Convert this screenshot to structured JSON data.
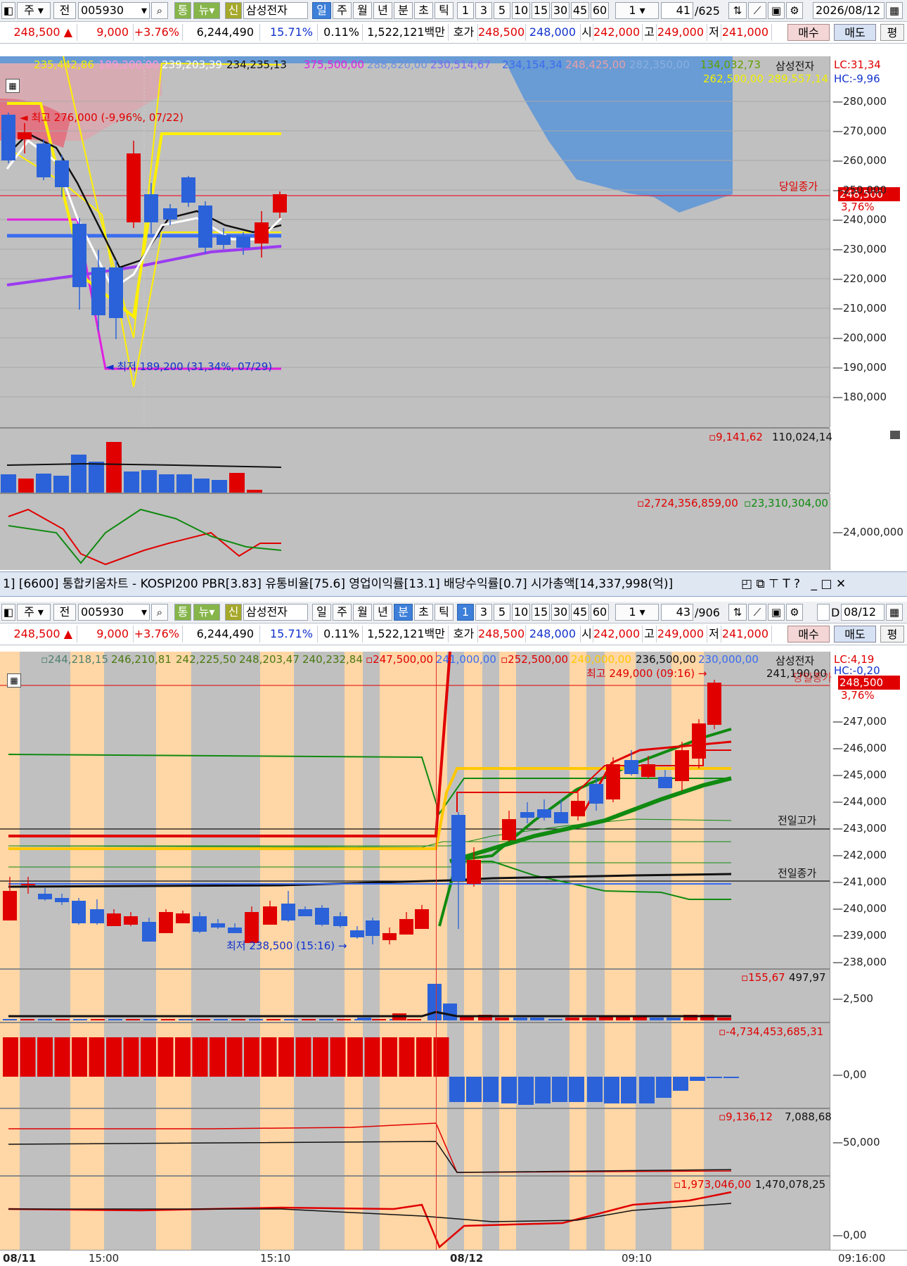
{
  "colors": {
    "up": "#e00000",
    "down": "#2b62d9",
    "panel": "#c0c0c0",
    "orange_band": "#ffd6a5"
  },
  "top": {
    "toolbar": {
      "type": "주",
      "prev": "전",
      "code": "005930",
      "btn_tong": "통",
      "btn_nyu": "뉴",
      "btn_sin": "신",
      "name": "삼성전자",
      "periods": [
        "일",
        "주",
        "월",
        "년",
        "분",
        "초",
        "틱"
      ],
      "selected_period": "일",
      "intervals": [
        "1",
        "3",
        "5",
        "10",
        "15",
        "30",
        "45",
        "60"
      ],
      "count": "1",
      "page": "41",
      "page_total": "/625",
      "date": "2026/08/12"
    },
    "info": {
      "price": "248,500 ▲",
      "change": "9,000",
      "pct": "+3.76%",
      "volume": "6,244,490",
      "turnover": "15.71%",
      "ratio": "0.11%",
      "amount": "1,522,121백만",
      "ask_label": "호가",
      "ask": "248,500",
      "bid": "248,000",
      "open_label": "시",
      "open": "242,000",
      "high_label": "고",
      "high": "249,000",
      "low_label": "저",
      "low": "241,000",
      "buy": "매수",
      "sell": "매도",
      "eval": "평"
    },
    "legend": {
      "v1": "235,442,86",
      "v2": "189,200,00",
      "v3": "239,203,39",
      "v4": "234,235,13",
      "v5": "375,500,00",
      "v6": "288,820,00",
      "v7": "230,514,67",
      "v8": "234,154,34",
      "v9": "248,425,00",
      "v10": "282,350,00",
      "v11": "134,032,73",
      "stock": "삼성전자",
      "lc": "LC:31,34",
      "v12": "262,500,00",
      "v13": "289,557,14",
      "hc": "HC:-9,96"
    },
    "annotations": {
      "high": "최고 276,000 (-9,96%, 07/22)",
      "low": "최저 189,200 (31,34%, 07/29)",
      "close_label": "당일종가",
      "price_box": "248,500",
      "price_pct": "3,76%"
    },
    "y_ticks": [
      "280,000",
      "270,000",
      "260,000",
      "250,000",
      "240,000",
      "230,000",
      "220,000",
      "210,000",
      "200,000",
      "190,000",
      "180,000"
    ],
    "vol_legend": {
      "a": "9,141,62",
      "b": "110,024,14"
    },
    "ind_legend": {
      "a": "2,724,356,859,00",
      "b": "23,310,304,00"
    },
    "ind_tick": "24,000,000"
  },
  "window": {
    "title": "1] [6600] 통합키움차트 - KOSPI200 PBR[3.83] 유통비율[75.6] 영업이익률[13.1] 배당수익률[0.7] 시가총액[14,337,998(억)]"
  },
  "bottom": {
    "toolbar": {
      "type": "주",
      "prev": "전",
      "code": "005930",
      "btn_tong": "통",
      "btn_nyu": "뉴",
      "btn_sin": "신",
      "name": "삼성전자",
      "periods": [
        "일",
        "주",
        "월",
        "년",
        "분",
        "초",
        "틱"
      ],
      "selected_period": "분",
      "intervals": [
        "1",
        "3",
        "5",
        "10",
        "15",
        "30",
        "45",
        "60"
      ],
      "selected_interval": "1",
      "count": "1",
      "page": "43",
      "page_total": "/906",
      "d_label": "D",
      "date": "08/12"
    },
    "info": {
      "price": "248,500 ▲",
      "change": "9,000",
      "pct": "+3.76%",
      "volume": "6,244,490",
      "turnover": "15.71%",
      "ratio": "0.11%",
      "amount": "1,522,121백만",
      "ask_label": "호가",
      "ask": "248,500",
      "bid": "248,000",
      "open_label": "시",
      "open": "242,000",
      "high_label": "고",
      "high": "249,000",
      "low_label": "저",
      "low": "241,000",
      "buy": "매수",
      "sell": "매도",
      "eval": "평"
    },
    "legend": {
      "v1": "244,218,15",
      "v2": "246,210,81",
      "v3": "242,225,50",
      "v4": "248,203,47",
      "v5": "240,232,84",
      "v6": "247,500,00",
      "v7": "241,000,00",
      "v8": "252,500,00",
      "v9": "240,000,00",
      "v10": "236,500,00",
      "v11": "230,000,00",
      "stock": "삼성전자",
      "lc": "LC:4,19",
      "hc": "HC:-0,20",
      "v12": "241,190,00"
    },
    "annotations": {
      "high": "최고 249,000 (09:16) →",
      "low": "최저 238,500 (15:16) →",
      "prev_high": "전일고가",
      "prev_close": "전일종가",
      "close_label": "당일종가",
      "price_box": "248,500",
      "price_pct": "3,76%"
    },
    "y_ticks": [
      "247,000",
      "246,000",
      "245,000",
      "244,000",
      "243,000",
      "242,000",
      "241,000",
      "240,000",
      "239,000",
      "238,000"
    ],
    "vol_legend": {
      "a": "155,67",
      "b": "497,97",
      "tick": "2,500"
    },
    "p3_legend": {
      "a": "-4,734,453,685,31",
      "tick": "0,00"
    },
    "p4_legend": {
      "a": "9,136,12",
      "b": "7,088,68",
      "tick": "50,000"
    },
    "p5_legend": {
      "a": "1,973,046,00",
      "b": "1,470,078,25",
      "tick": "0,00"
    },
    "x_labels": {
      "d1": "08/11",
      "t1": "15:00",
      "t2": "15:10",
      "d2": "08/12",
      "t3": "09:10",
      "cur": "09:16:00"
    }
  }
}
